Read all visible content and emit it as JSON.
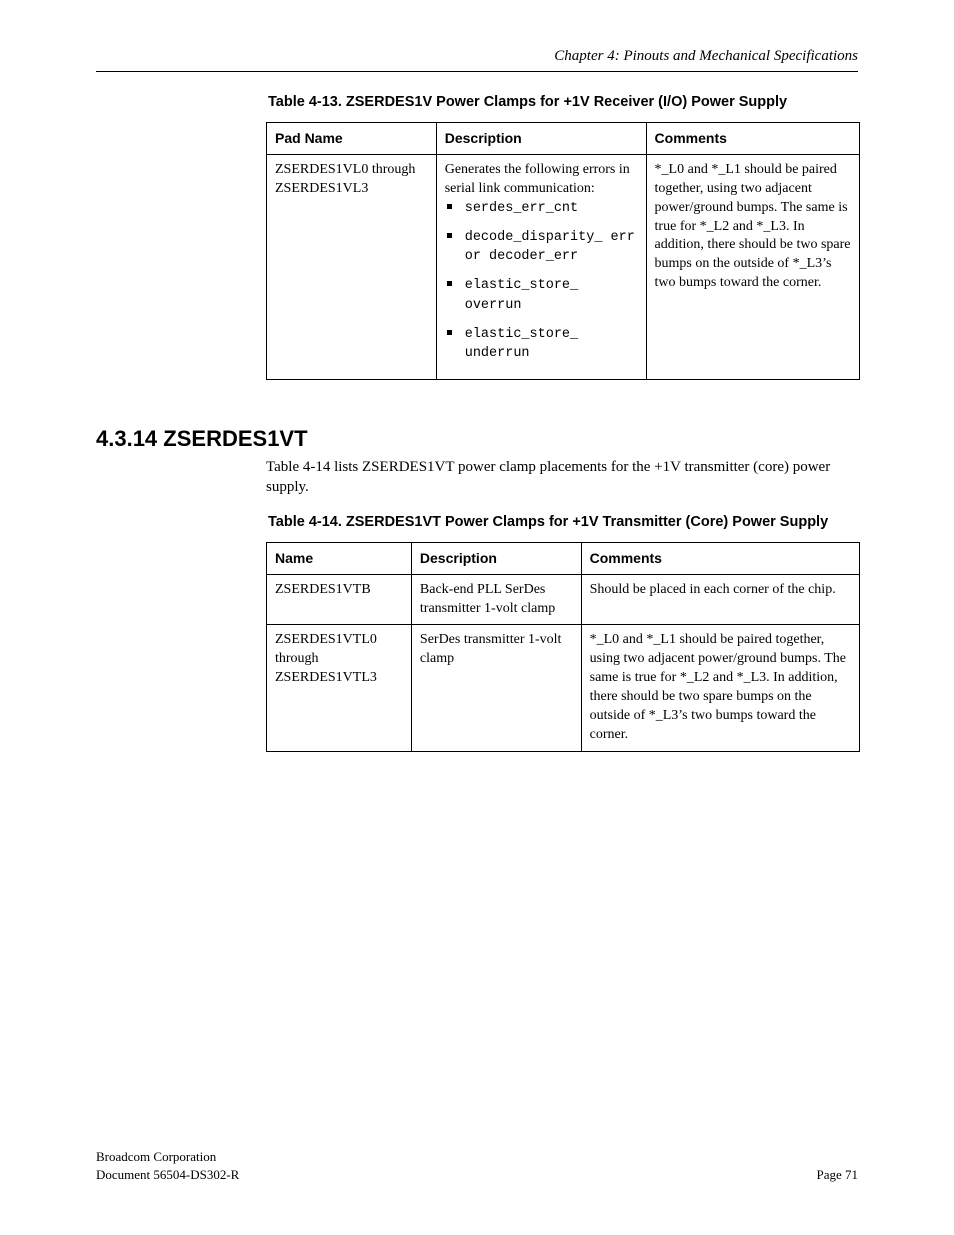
{
  "header": {
    "running": "Chapter 4: Pinouts and Mechanical Specifications"
  },
  "section_a": {
    "caption": "Table 4-13. ZSERDES1V Power Clamps for +1V Receiver (I/O) Power Supply",
    "columns": [
      "Pad Name",
      "Description",
      "Comments"
    ],
    "row": {
      "pad_name": "ZSERDES1VL0 through ZSERDES1VL3",
      "errs_intro": "Generates the following errors in serial link communication:",
      "errors": [
        "serdes_err_cnt",
        "decode_disparity_ err or decoder_err",
        "elastic_store_ overrun",
        "elastic_store_ underrun"
      ],
      "comments": "*_L0 and *_L1 should be paired together, using two adjacent power/ground bumps. The same is true for *_L2 and *_L3. In addition, there should be two spare bumps on the outside of *_L3’s two bumps toward the corner."
    }
  },
  "section_b": {
    "heading": "4.3.14 ZSERDES1VT",
    "blurb": "Table 4-14 lists ZSERDES1VT power clamp placements for the +1V transmitter (core) power supply.",
    "caption": "Table 4-14. ZSERDES1VT Power Clamps for +1V Transmitter (Core) Power Supply",
    "columns": [
      "Name",
      "Description",
      "Comments"
    ],
    "rows": [
      {
        "name": "ZSERDES1VTB",
        "desc": "Back-end PLL SerDes transmitter 1-volt clamp",
        "comments": "Should be placed in each corner of the chip."
      },
      {
        "name": "ZSERDES1VTL0 through ZSERDES1VTL3",
        "desc": "SerDes transmitter 1-volt clamp",
        "comments": "*_L0 and *_L1 should be paired together, using two adjacent power/ground bumps. The same is true for *_L2 and *_L3. In addition, there should be two spare bumps on the outside of *_L3’s two bumps toward the corner."
      }
    ]
  },
  "footer": {
    "line1": "Broadcom Corporation",
    "line2_left": "Document   56504-DS302-R",
    "page": "Page   71"
  }
}
